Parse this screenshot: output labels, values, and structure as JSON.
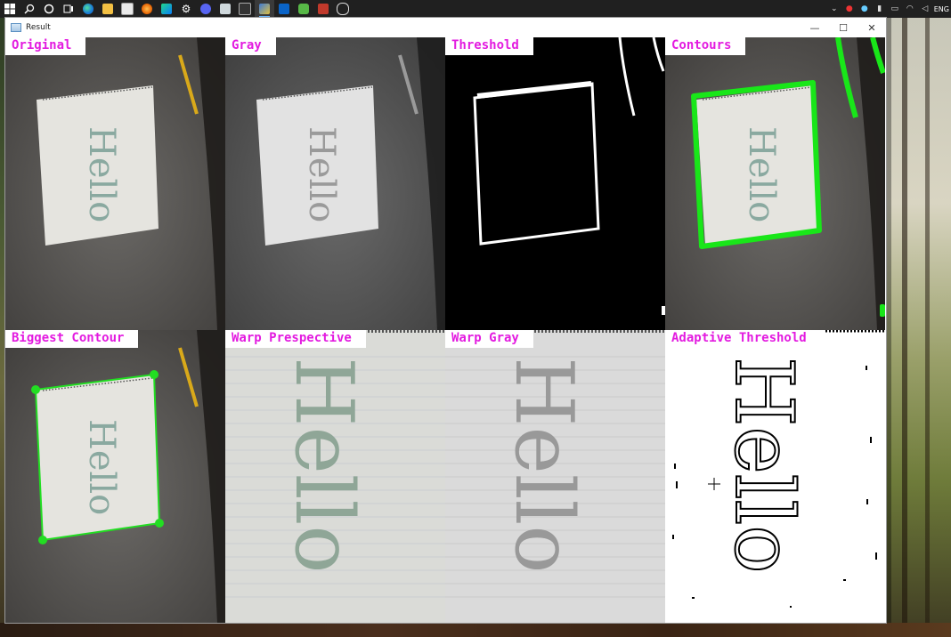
{
  "taskbar": {
    "icons": [
      "windows-start-icon",
      "search-icon",
      "cortana-icon",
      "task-view-icon",
      "edge-icon",
      "file-explorer-icon",
      "store-icon",
      "firefox-icon",
      "pycharm-icon",
      "settings-icon",
      "discord-icon",
      "mail-icon",
      "terminal-icon",
      "opencv-app-icon",
      "outlook-icon",
      "photos-icon",
      "snip-icon",
      "clock-app-icon"
    ],
    "tray_language": "ENG"
  },
  "window": {
    "title": "Result",
    "min_glyph": "—",
    "max_glyph": "☐",
    "close_glyph": "✕"
  },
  "panels": [
    {
      "id": "original",
      "label": "Original"
    },
    {
      "id": "gray",
      "label": "Gray"
    },
    {
      "id": "threshold",
      "label": "Threshold"
    },
    {
      "id": "contours",
      "label": "Contours"
    },
    {
      "id": "biggest-contour",
      "label": "Biggest Contour"
    },
    {
      "id": "warp-prespective",
      "label": "Warp Prespective"
    },
    {
      "id": "warp-gray",
      "label": "Warp Gray"
    },
    {
      "id": "adaptive-threshold",
      "label": "Adaptive Threshold"
    }
  ],
  "colors": {
    "label_text": "#e31be0",
    "contour_green": "#19e619",
    "biggest_contour_green": "#22dd22"
  }
}
